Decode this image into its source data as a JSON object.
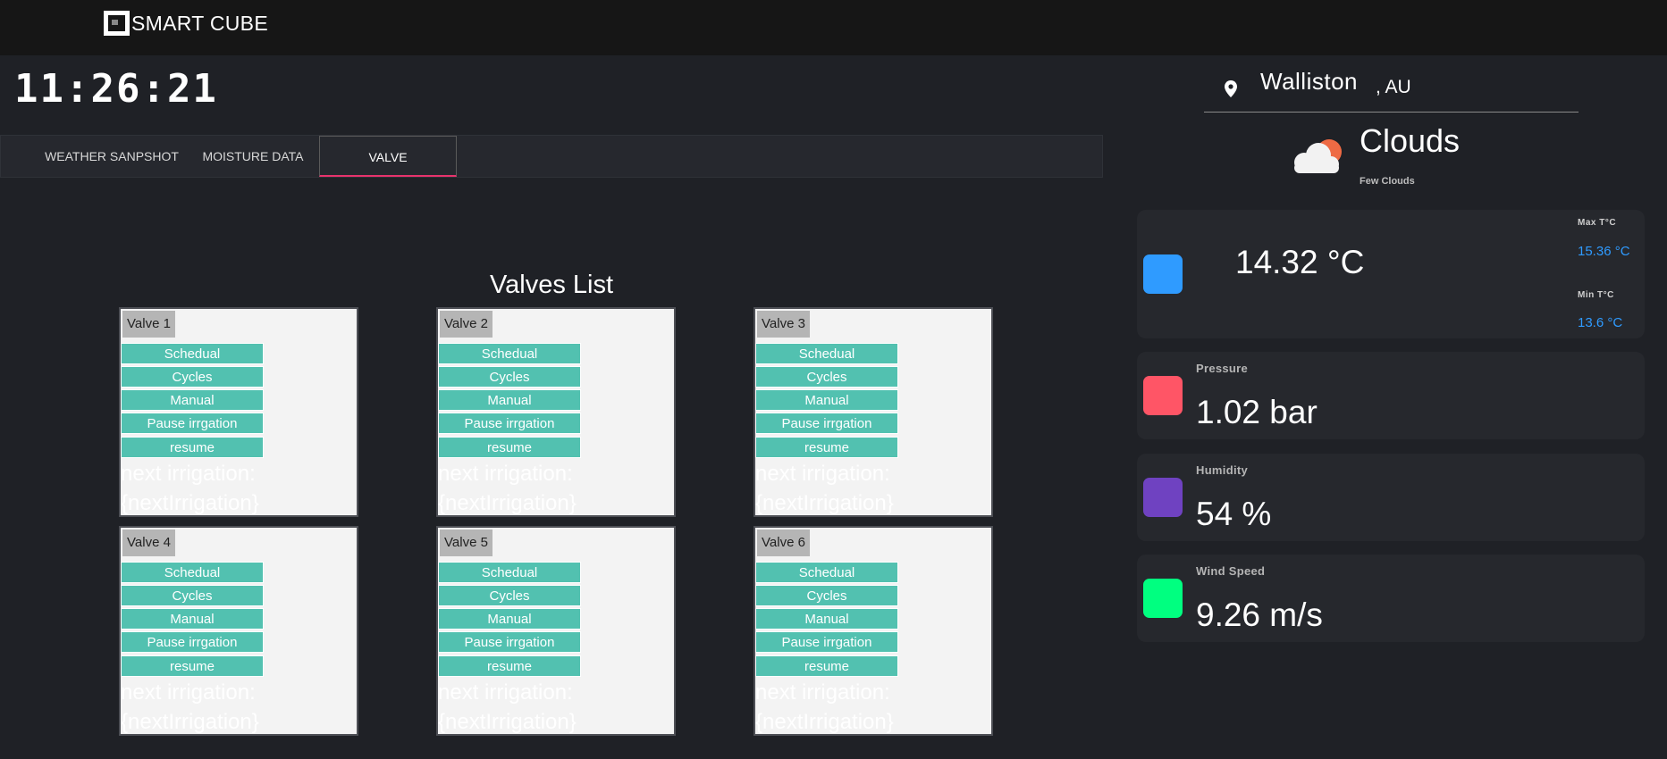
{
  "app": {
    "name": "SMART CUBE",
    "clock": "11:26:21"
  },
  "tabs": [
    {
      "label": "WEATHER SANPSHOT",
      "active": false
    },
    {
      "label": "MOISTURE DATA",
      "active": false
    },
    {
      "label": "VALVE",
      "active": true
    }
  ],
  "valves": {
    "title": "Valves List",
    "items": [
      {
        "name": "Valve 1",
        "buttons": [
          "Schedual",
          "Cycles",
          "Manual",
          "Pause irrgation",
          "resume"
        ],
        "next_label": "next irrigation:",
        "next_value": "{nextIrrigation}"
      },
      {
        "name": "Valve 2",
        "buttons": [
          "Schedual",
          "Cycles",
          "Manual",
          "Pause irrgation",
          "resume"
        ],
        "next_label": "next irrigation:",
        "next_value": "{nextIrrigation}"
      },
      {
        "name": "Valve 3",
        "buttons": [
          "Schedual",
          "Cycles",
          "Manual",
          "Pause irrgation",
          "resume"
        ],
        "next_label": "next irrigation:",
        "next_value": "{nextIrrigation}"
      },
      {
        "name": "Valve 4",
        "buttons": [
          "Schedual",
          "Cycles",
          "Manual",
          "Pause irrgation",
          "resume"
        ],
        "next_label": "next irrigation:",
        "next_value": "{nextIrrigation}"
      },
      {
        "name": "Valve 5",
        "buttons": [
          "Schedual",
          "Cycles",
          "Manual",
          "Pause irrgation",
          "resume"
        ],
        "next_label": "next irrigation:",
        "next_value": "{nextIrrigation}"
      },
      {
        "name": "Valve 6",
        "buttons": [
          "Schedual",
          "Cycles",
          "Manual",
          "Pause irrgation",
          "resume"
        ],
        "next_label": "next irrigation:",
        "next_value": "{nextIrrigation}"
      }
    ]
  },
  "weather": {
    "city": "Walliston",
    "country": ", AU",
    "condition": "Clouds",
    "description": "Few Clouds",
    "icon": "partly-cloudy-icon",
    "temperature": {
      "value": "14.32 °C",
      "max_label": "Max T°C",
      "max_value": "15.36 °C",
      "min_label": "Min T°C",
      "min_value": "13.6 °C",
      "color": "#2f9bff"
    },
    "pressure": {
      "label": "Pressure",
      "value": "1.02 bar",
      "color": "#ff5566"
    },
    "humidity": {
      "label": "Humidity",
      "value": "54 %",
      "color": "#6f42c1"
    },
    "wind": {
      "label": "Wind Speed",
      "value": "9.26 m/s",
      "color": "#00ff80"
    }
  },
  "colors": {
    "accent_tab": "#e8336d",
    "button": "#52c1b0",
    "background": "#1f2126",
    "max_min_value": "#2f9bff"
  }
}
